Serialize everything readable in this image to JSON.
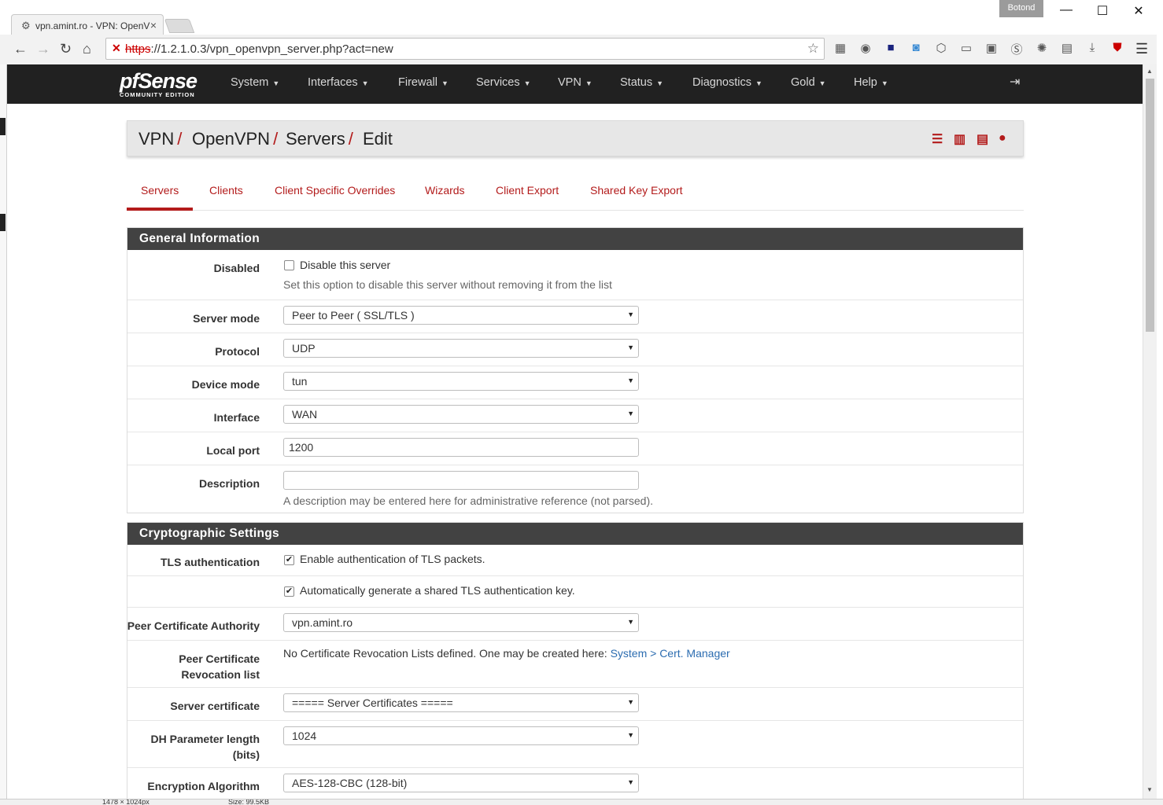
{
  "browser": {
    "tab_title": "vpn.amint.ro - VPN: OpenV",
    "profile_name": "Botond",
    "url_scheme": "https",
    "url_rest": "://1.2.1.0.3/vpn_openvpn_server.php?act=new",
    "window_controls": {
      "minimize": "—",
      "maximize": "☐",
      "close": "✕"
    }
  },
  "navbar": {
    "brand_logo": "pfSense",
    "brand_sub": "COMMUNITY EDITION",
    "items": [
      {
        "label": "System"
      },
      {
        "label": "Interfaces"
      },
      {
        "label": "Firewall"
      },
      {
        "label": "Services"
      },
      {
        "label": "VPN"
      },
      {
        "label": "Status"
      },
      {
        "label": "Diagnostics"
      },
      {
        "label": "Gold"
      },
      {
        "label": "Help"
      }
    ]
  },
  "breadcrumb": [
    "VPN",
    "OpenVPN",
    "Servers",
    "Edit"
  ],
  "tabs": [
    {
      "label": "Servers",
      "active": true
    },
    {
      "label": "Clients"
    },
    {
      "label": "Client Specific Overrides"
    },
    {
      "label": "Wizards"
    },
    {
      "label": "Client Export"
    },
    {
      "label": "Shared Key Export"
    }
  ],
  "general": {
    "title": "General Information",
    "disabled_label": "Disabled",
    "disabled_checkbox_text": "Disable this server",
    "disabled_help": "Set this option to disable this server without removing it from the list",
    "server_mode_label": "Server mode",
    "server_mode_value": "Peer to Peer ( SSL/TLS )",
    "protocol_label": "Protocol",
    "protocol_value": "UDP",
    "device_mode_label": "Device mode",
    "device_mode_value": "tun",
    "interface_label": "Interface",
    "interface_value": "WAN",
    "local_port_label": "Local port",
    "local_port_value": "1200",
    "description_label": "Description",
    "description_value": "",
    "description_help": "A description may be entered here for administrative reference (not parsed)."
  },
  "crypto": {
    "title": "Cryptographic Settings",
    "tls_auth_label": "TLS authentication",
    "tls_auth_text": "Enable authentication of TLS packets.",
    "tls_auto_text": "Automatically generate a shared TLS authentication key.",
    "peer_ca_label": "Peer Certificate Authority",
    "peer_ca_value": "vpn.amint.ro",
    "peer_crl_label_1": "Peer Certificate",
    "peer_crl_label_2": "Revocation list",
    "peer_crl_text": "No Certificate Revocation Lists defined. One may be created here: ",
    "peer_crl_link": "System > Cert. Manager",
    "server_cert_label": "Server certificate",
    "server_cert_value": "===== Server Certificates =====",
    "dh_label_1": "DH Parameter length",
    "dh_label_2": "(bits)",
    "dh_value": "1024",
    "enc_label": "Encryption Algorithm",
    "enc_value": "AES-128-CBC (128-bit)"
  },
  "statusbar": {
    "dims": "1478 × 1024px",
    "size": "Size: 99.5KB"
  },
  "colors": {
    "accent": "#b31b1b",
    "navbar": "#212121",
    "section_header": "#424242"
  }
}
